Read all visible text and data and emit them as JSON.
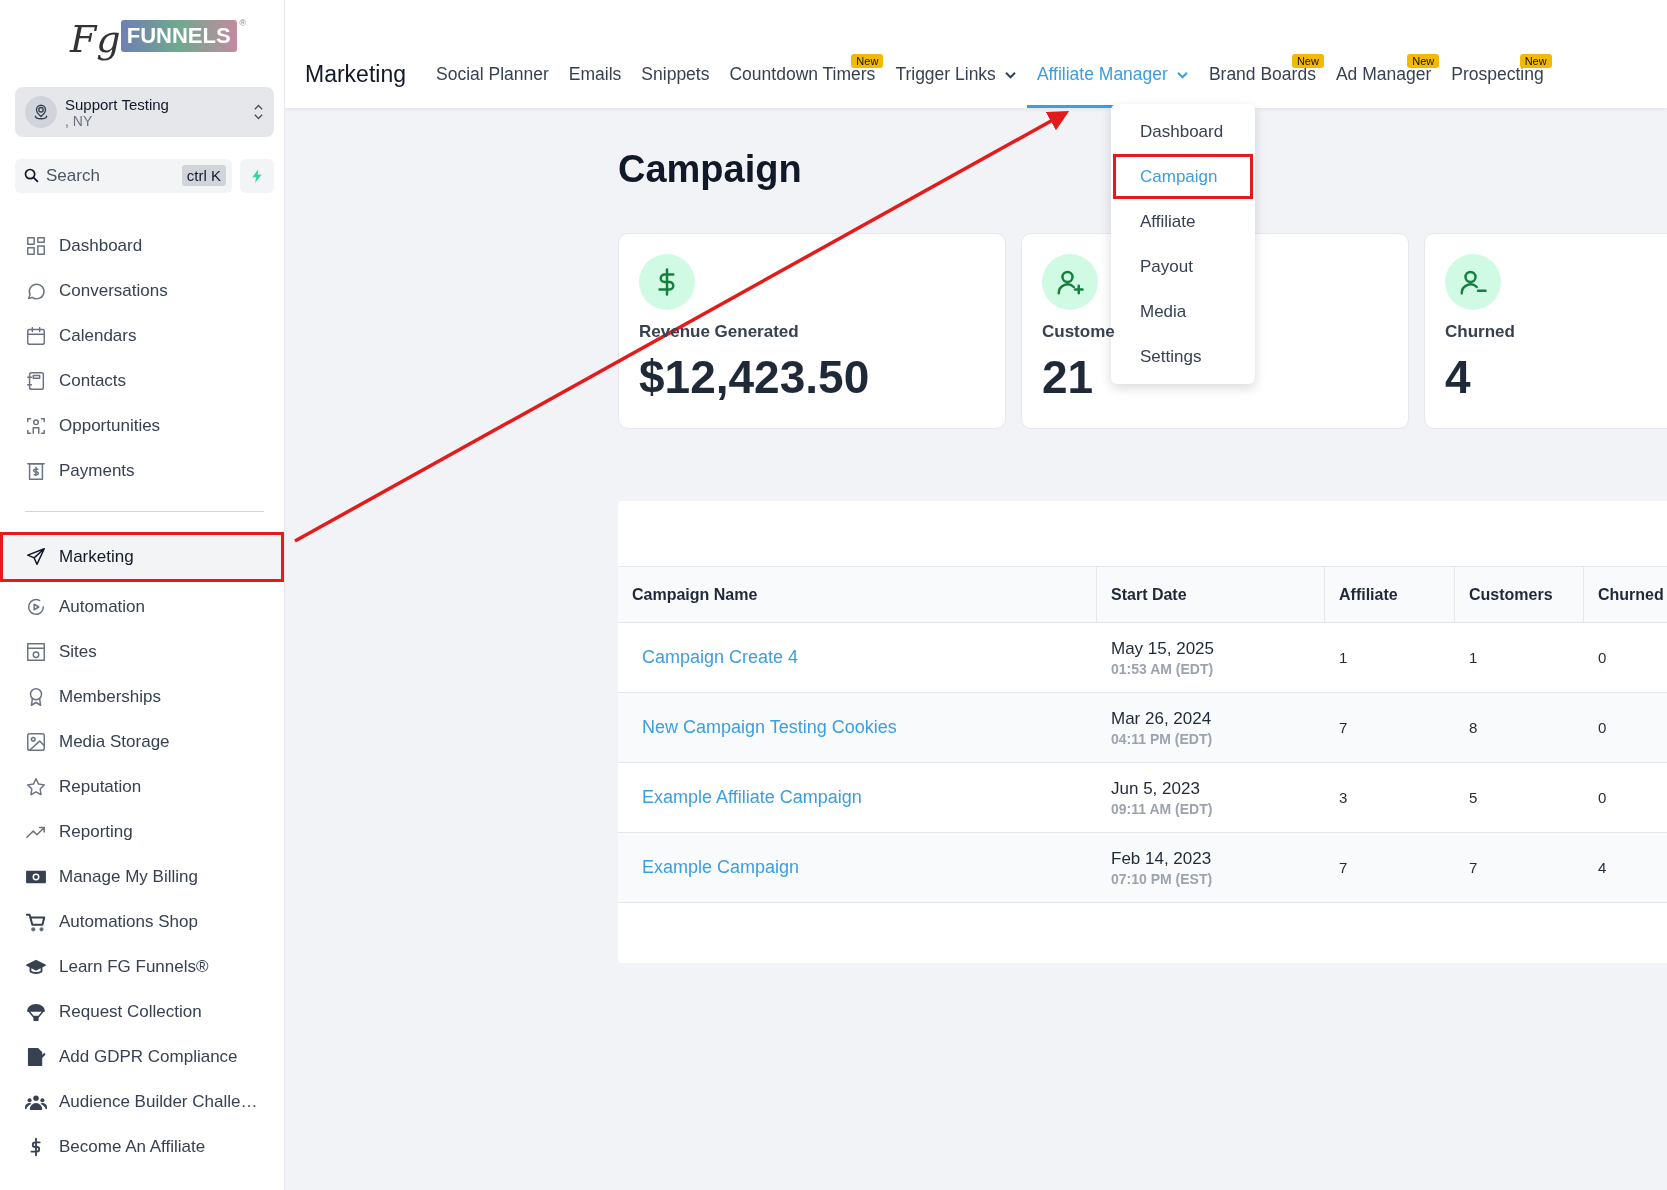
{
  "logo": {
    "script": "Fg",
    "word": "FUNNELS",
    "mark": "®"
  },
  "account": {
    "name": "Support Testing",
    "location": ", NY"
  },
  "search": {
    "placeholder": "Search",
    "shortcut": "ctrl K"
  },
  "sidebar": {
    "items": [
      {
        "label": "Dashboard",
        "selected": false,
        "highlighted": false
      },
      {
        "label": "Conversations",
        "selected": false,
        "highlighted": false
      },
      {
        "label": "Calendars",
        "selected": false,
        "highlighted": false
      },
      {
        "label": "Contacts",
        "selected": false,
        "highlighted": false
      },
      {
        "label": "Opportunities",
        "selected": false,
        "highlighted": false
      },
      {
        "label": "Payments",
        "selected": false,
        "highlighted": false
      }
    ],
    "items_2": [
      {
        "label": "Marketing",
        "selected": true,
        "highlighted": true
      },
      {
        "label": "Automation",
        "selected": false,
        "highlighted": false
      },
      {
        "label": "Sites",
        "selected": false,
        "highlighted": false
      },
      {
        "label": "Memberships",
        "selected": false,
        "highlighted": false
      },
      {
        "label": "Media Storage",
        "selected": false,
        "highlighted": false
      },
      {
        "label": "Reputation",
        "selected": false,
        "highlighted": false
      },
      {
        "label": "Reporting",
        "selected": false,
        "highlighted": false
      },
      {
        "label": "Manage My Billing",
        "selected": false,
        "highlighted": false
      },
      {
        "label": "Automations Shop",
        "selected": false,
        "highlighted": false
      },
      {
        "label": "Learn FG Funnels®",
        "selected": false,
        "highlighted": false
      },
      {
        "label": "Request Collection",
        "selected": false,
        "highlighted": false
      },
      {
        "label": "Add GDPR Compliance",
        "selected": false,
        "highlighted": false
      },
      {
        "label": "Audience Builder Challe…",
        "selected": false,
        "highlighted": false
      },
      {
        "label": "Become An Affiliate",
        "selected": false,
        "highlighted": false
      }
    ]
  },
  "topbar": {
    "title": "Marketing",
    "tabs": [
      {
        "label": "Social Planner",
        "selected": false,
        "dropdown": false
      },
      {
        "label": "Emails",
        "selected": false,
        "dropdown": false
      },
      {
        "label": "Snippets",
        "selected": false,
        "dropdown": false
      },
      {
        "label": "Countdown Timers",
        "selected": false,
        "dropdown": false,
        "badge": "New"
      },
      {
        "label": "Trigger Links",
        "selected": false,
        "dropdown": true
      },
      {
        "label": "Affiliate Manager",
        "selected": true,
        "dropdown": true
      },
      {
        "label": "Brand Boards",
        "selected": false,
        "dropdown": false,
        "badge": "New"
      },
      {
        "label": "Ad Manager",
        "selected": false,
        "dropdown": false,
        "badge": "New"
      },
      {
        "label": "Prospecting",
        "selected": false,
        "dropdown": false,
        "badge": "New"
      }
    ]
  },
  "dropdown_menu": {
    "items": [
      {
        "label": "Dashboard",
        "selected": false,
        "highlighted": false
      },
      {
        "label": "Campaign",
        "selected": true,
        "highlighted": true
      },
      {
        "label": "Affiliate",
        "selected": false,
        "highlighted": false
      },
      {
        "label": "Payout",
        "selected": false,
        "highlighted": false
      },
      {
        "label": "Media",
        "selected": false,
        "highlighted": false
      },
      {
        "label": "Settings",
        "selected": false,
        "highlighted": false
      }
    ]
  },
  "page_title": "Campaign",
  "stats": [
    {
      "label": "Revenue Generated",
      "value": "$12,423.50"
    },
    {
      "label": "Custome",
      "value": "21"
    },
    {
      "label": "Churned",
      "value": "4"
    }
  ],
  "table": {
    "columns": [
      "Campaign Name",
      "Start Date",
      "Affiliate",
      "Customers",
      "Churned"
    ],
    "rows": [
      {
        "name": "Campaign Create 4",
        "date": "May 15, 2025",
        "time": "01:53 AM (EDT)",
        "affiliate": "1",
        "customers": "1",
        "churned": "0"
      },
      {
        "name": "New Campaign Testing Cookies",
        "date": "Mar 26, 2024",
        "time": "04:11 PM (EDT)",
        "affiliate": "7",
        "customers": "8",
        "churned": "0"
      },
      {
        "name": "Example Affiliate Campaign",
        "date": "Jun 5, 2023",
        "time": "09:11 AM (EDT)",
        "affiliate": "3",
        "customers": "5",
        "churned": "0"
      },
      {
        "name": "Example Campaign",
        "date": "Feb 14, 2023",
        "time": "07:10 PM (EST)",
        "affiliate": "7",
        "customers": "7",
        "churned": "4"
      }
    ]
  }
}
